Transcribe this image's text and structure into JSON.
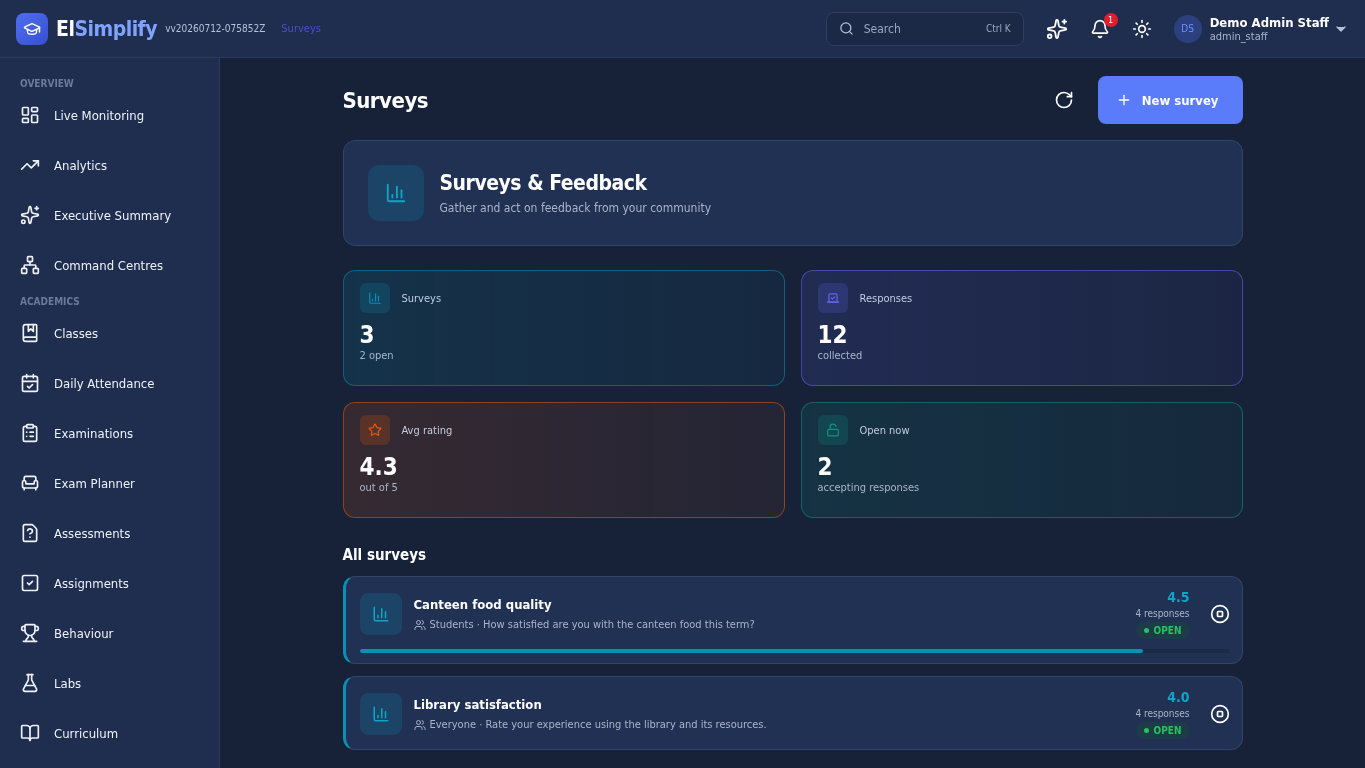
{
  "header": {
    "brand_a": "El",
    "brand_b": "Simplify",
    "version": "vv20260712-075852Z",
    "breadcrumb": "Surveys",
    "search": {
      "placeholder": "Search",
      "shortcut": "Ctrl K"
    },
    "notifications": "1",
    "user": {
      "initials": "DS",
      "name": "Demo Admin Staff",
      "username": "admin_staff"
    }
  },
  "sidebar": {
    "sections": [
      {
        "title": "OVERVIEW",
        "items": [
          {
            "label": "Live Monitoring",
            "selected": false
          },
          {
            "label": "Analytics",
            "selected": false
          },
          {
            "label": "Executive Summary",
            "selected": false
          },
          {
            "label": "Command Centres",
            "selected": false
          }
        ]
      },
      {
        "title": "ACADEMICS",
        "items": [
          {
            "label": "Classes",
            "selected": false
          },
          {
            "label": "Daily Attendance",
            "selected": false
          },
          {
            "label": "Examinations",
            "selected": false
          },
          {
            "label": "Exam Planner",
            "selected": false
          },
          {
            "label": "Assessments",
            "selected": false
          },
          {
            "label": "Assignments",
            "selected": false
          },
          {
            "label": "Behaviour",
            "selected": false
          },
          {
            "label": "Labs",
            "selected": false
          },
          {
            "label": "Curriculum",
            "selected": false
          }
        ]
      }
    ]
  },
  "page": {
    "title": "Surveys",
    "new_button": "New survey"
  },
  "hero": {
    "title": "Surveys & Feedback",
    "subtitle": "Gather and act on feedback from your community"
  },
  "stats": [
    {
      "label": "Surveys",
      "value": "3",
      "note": "2 open",
      "color": "#0891b2"
    },
    {
      "label": "Responses",
      "value": "12",
      "note": "collected",
      "color": "#6366f1"
    },
    {
      "label": "Avg rating",
      "value": "4.3",
      "note": "out of 5",
      "color": "#ea580c"
    },
    {
      "label": "Open now",
      "value": "2",
      "note": "accepting responses",
      "color": "#0d9488"
    }
  ],
  "list_title": "All surveys",
  "surveys": [
    {
      "title": "Canteen food quality",
      "description": "Students · How satisfied are you with the canteen food this term?",
      "rating": "4.5",
      "responses": "4 responses",
      "status": "OPEN",
      "open": true,
      "level": 0.9
    },
    {
      "title": "Library satisfaction",
      "description": "Everyone · Rate your experience using the library and its resources.",
      "rating": "4.0",
      "responses": "4 responses",
      "status": "OPEN",
      "open": true
    }
  ]
}
